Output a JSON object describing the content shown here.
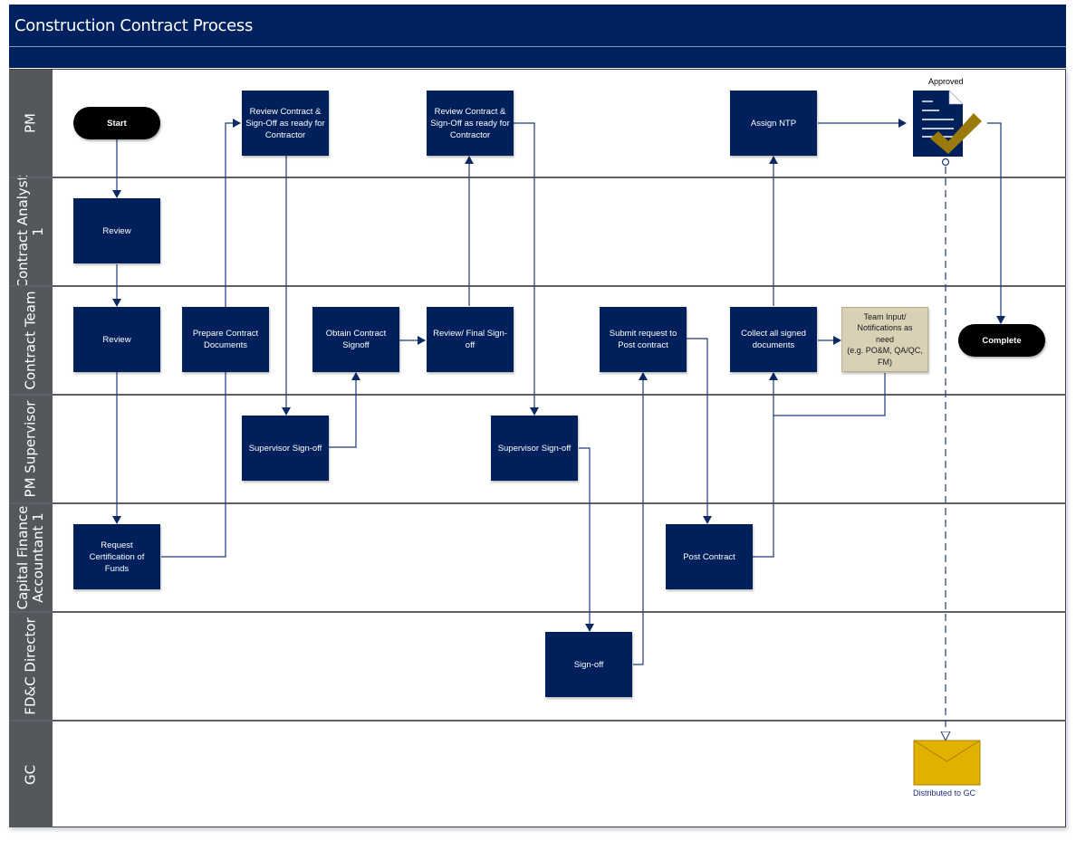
{
  "header": {
    "title": "Construction Contract Process"
  },
  "colors": {
    "header_bg": "#00215f",
    "lane_label_bg": "#54575b",
    "process_box": "#00205b",
    "note_box": "#d8d1b5",
    "check": "#9a7a0a",
    "envelope": "#e2b100",
    "connector": "#1f3a78"
  },
  "lanes": [
    {
      "label": "PM"
    },
    {
      "label": "Contract Analyst\n1"
    },
    {
      "label": "Contract Team"
    },
    {
      "label": "PM Supervisor"
    },
    {
      "label": "Capital Finance\nAccountant 1"
    },
    {
      "label": "FD&C Director"
    },
    {
      "label": "GC"
    }
  ],
  "nodes": {
    "start": "Start",
    "complete": "Complete",
    "ca_review": "Review",
    "ct_review": "Review",
    "prepare_docs": "Prepare Contract Documents",
    "pm_review_1": "Review Contract &\nSign-Off as ready for\nContractor",
    "pm_review_2": "Review Contract &\nSign-Off as ready for\nContractor",
    "obtain_signoff": "Obtain Contract\nSignoff",
    "final_signoff": "Review/ Final Sign-\noff",
    "submit_post": "Submit request to\nPost contract",
    "collect_docs": "Collect all signed\ndocuments",
    "team_input": "Team Input/\nNotifications as\nneed\n(e.g. PO&M, QA/QC,\nFM)",
    "assign_ntp": "Assign NTP",
    "sup_signoff_1": "Supervisor Sign-off",
    "sup_signoff_2": "Supervisor Sign-off",
    "request_cert": "Request\nCertification of\nFunds",
    "post_contract": "Post Contract",
    "director_signoff": "Sign-off",
    "approved_label": "Approved",
    "distributed_label": "Distributed to GC"
  }
}
